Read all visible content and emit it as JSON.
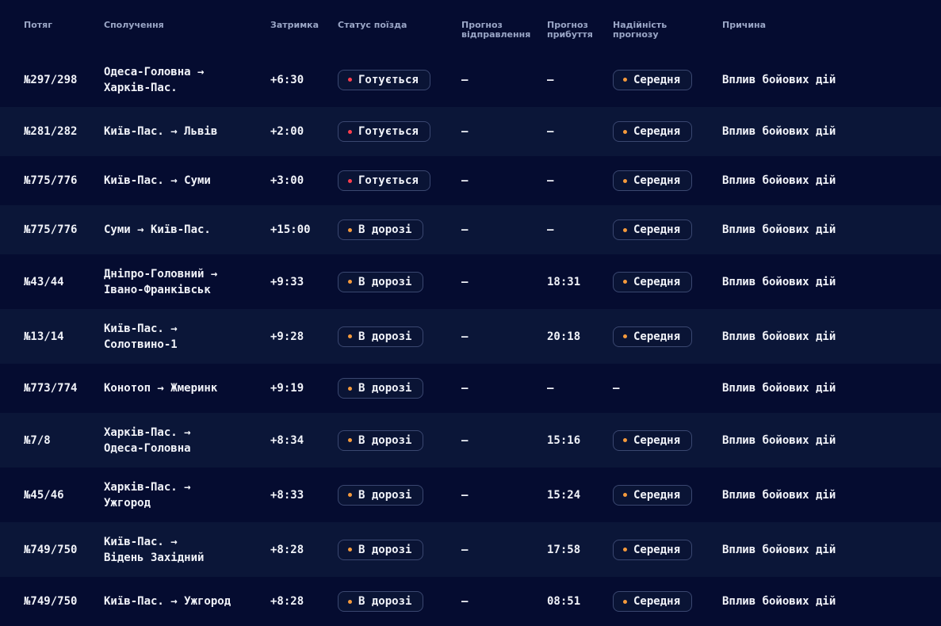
{
  "table": {
    "headers": {
      "train": "Потяг",
      "route": "Сполучення",
      "delay": "Затримка",
      "status": "Статус поїзда",
      "departure_forecast": "Прогноз\nвідправлення",
      "arrival_forecast": "Прогноз\nприбуття",
      "reliability": "Надійність\nпрогнозу",
      "reason": "Причина"
    },
    "colors": {
      "status_dot_preparing": "#ff3e4d",
      "status_dot_on_route": "#f59a3c",
      "reliability_dot": "#f59a3c",
      "delay_text": "#ff3e4d"
    },
    "rows": [
      {
        "train": "№297/298",
        "route": "Одеса-Головна →\nХарків-Пас.",
        "delay": "+6:30",
        "status": "Готується",
        "departure": "—",
        "arrival": "—",
        "reliability": "Середня",
        "reason": "Вплив бойових дій"
      },
      {
        "train": "№281/282",
        "route": "Київ-Пас. → Львів",
        "delay": "+2:00",
        "status": "Готується",
        "departure": "—",
        "arrival": "—",
        "reliability": "Середня",
        "reason": "Вплив бойових дій"
      },
      {
        "train": "№775/776",
        "route": "Київ-Пас. → Суми",
        "delay": "+3:00",
        "status": "Готується",
        "departure": "—",
        "arrival": "—",
        "reliability": "Середня",
        "reason": "Вплив бойових дій"
      },
      {
        "train": "№775/776",
        "route": "Суми → Київ-Пас.",
        "delay": "+15:00",
        "status": "В дорозі",
        "departure": "—",
        "arrival": "—",
        "reliability": "Середня",
        "reason": "Вплив бойових дій"
      },
      {
        "train": "№43/44",
        "route": "Дніпро-Головний →\nІвано-Франківськ",
        "delay": "+9:33",
        "status": "В дорозі",
        "departure": "—",
        "arrival": "18:31",
        "reliability": "Середня",
        "reason": "Вплив бойових дій"
      },
      {
        "train": "№13/14",
        "route": "Київ-Пас. →\nСолотвино-1",
        "delay": "+9:28",
        "status": "В дорозі",
        "departure": "—",
        "arrival": "20:18",
        "reliability": "Середня",
        "reason": "Вплив бойових дій"
      },
      {
        "train": "№773/774",
        "route": "Конотоп → Жмеринк",
        "delay": "+9:19",
        "status": "В дорозі",
        "departure": "—",
        "arrival": "—",
        "reliability": "—",
        "reason": "Вплив бойових дій"
      },
      {
        "train": "№7/8",
        "route": "Харків-Пас. →\nОдеса-Головна",
        "delay": "+8:34",
        "status": "В дорозі",
        "departure": "—",
        "arrival": "15:16",
        "reliability": "Середня",
        "reason": "Вплив бойових дій"
      },
      {
        "train": "№45/46",
        "route": "Харків-Пас. →\nУжгород",
        "delay": "+8:33",
        "status": "В дорозі",
        "departure": "—",
        "arrival": "15:24",
        "reliability": "Середня",
        "reason": "Вплив бойових дій"
      },
      {
        "train": "№749/750",
        "route": "Київ-Пас. →\nВідень Західний",
        "delay": "+8:28",
        "status": "В дорозі",
        "departure": "—",
        "arrival": "17:58",
        "reliability": "Середня",
        "reason": "Вплив бойових дій"
      },
      {
        "train": "№749/750",
        "route": "Київ-Пас. → Ужгород",
        "delay": "+8:28",
        "status": "В дорозі",
        "departure": "—",
        "arrival": "08:51",
        "reliability": "Середня",
        "reason": "Вплив бойових дій"
      }
    ]
  }
}
